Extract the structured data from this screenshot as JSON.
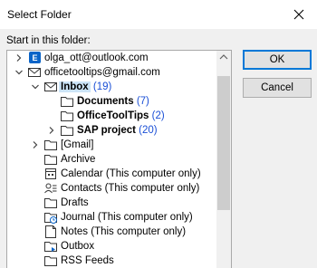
{
  "window": {
    "title": "Select Folder"
  },
  "label": "Start in this folder:",
  "tree": [
    {
      "text": "olga_ott@outlook.com",
      "icon": "exchange-account-icon",
      "arrow": "right",
      "bold": false
    },
    {
      "text": "officetooltips@gmail.com",
      "icon": "mail-account-icon",
      "arrow": "down",
      "bold": false
    },
    {
      "text": "Inbox",
      "count": "(19)",
      "icon": "inbox-icon",
      "arrow": "down",
      "bold": true,
      "selected": true
    },
    {
      "text": "Documents",
      "count": "(7)",
      "icon": "folder-icon",
      "arrow": "",
      "bold": true
    },
    {
      "text": "OfficeToolTips",
      "count": "(2)",
      "icon": "folder-icon",
      "arrow": "",
      "bold": true
    },
    {
      "text": "SAP project",
      "count": "(20)",
      "icon": "folder-icon",
      "arrow": "right",
      "bold": true
    },
    {
      "text": "[Gmail]",
      "icon": "folder-icon",
      "arrow": "right",
      "bold": false
    },
    {
      "text": "Archive",
      "icon": "folder-icon",
      "arrow": "",
      "bold": false
    },
    {
      "text": "Calendar (This computer only)",
      "icon": "calendar-icon",
      "arrow": "",
      "bold": false
    },
    {
      "text": "Contacts (This computer only)",
      "icon": "contacts-icon",
      "arrow": "",
      "bold": false
    },
    {
      "text": "Drafts",
      "icon": "folder-icon",
      "arrow": "",
      "bold": false
    },
    {
      "text": "Journal (This computer only)",
      "icon": "journal-icon",
      "arrow": "",
      "bold": false
    },
    {
      "text": "Notes (This computer only)",
      "icon": "notes-icon",
      "arrow": "",
      "bold": false
    },
    {
      "text": "Outbox",
      "icon": "outbox-icon",
      "arrow": "",
      "bold": false
    },
    {
      "text": "RSS Feeds",
      "icon": "rss-icon",
      "arrow": "",
      "bold": false
    }
  ],
  "buttons": {
    "ok": "OK",
    "cancel": "Cancel"
  }
}
